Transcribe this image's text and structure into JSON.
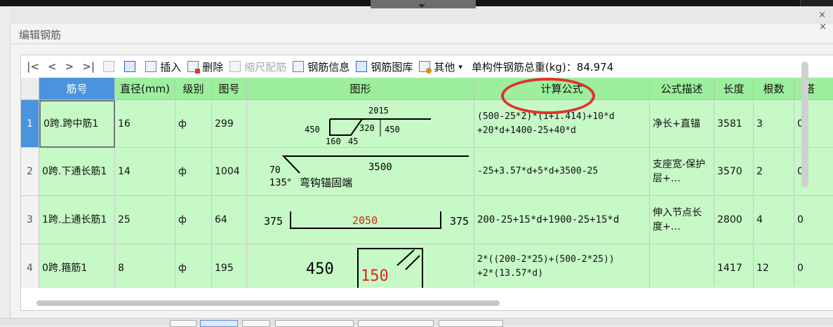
{
  "panel": {
    "title": "编辑钢筋",
    "close": "×"
  },
  "toolbar": {
    "nav": [
      "|<",
      "<",
      ">",
      ">|"
    ],
    "insert": "插入",
    "delete": "删除",
    "scale": "缩尺配筋",
    "info": "钢筋信息",
    "library": "钢筋图库",
    "other": "其他",
    "other_caret": "▾",
    "weight": "单构件钢筋总重(kg)：84.974"
  },
  "columns": [
    "筋号",
    "直径(mm)",
    "级别",
    "图号",
    "图形",
    "计算公式",
    "公式描述",
    "长度",
    "根数",
    "搭"
  ],
  "rows": [
    {
      "num": "1",
      "name": "0跨.跨中筋1",
      "dia": "16",
      "grade": "ф",
      "fig": "299",
      "formula": [
        "(500-25*2)*(1+1.414)+10*d",
        "+20*d+1400-25+40*d"
      ],
      "desc": "净长+直锚",
      "len": "3581",
      "count": "3",
      "lap": "0",
      "shape": {
        "top": "2015",
        "left": "450",
        "mid": "320",
        "right": "450",
        "b1": "160",
        "b2": "45"
      }
    },
    {
      "num": "2",
      "name": "0跨.下通长筋1",
      "dia": "14",
      "grade": "ф",
      "fig": "1004",
      "formula": [
        "-25+3.57*d+5*d+3500-25"
      ],
      "desc": "支座宽-保护层+…",
      "len": "3570",
      "count": "2",
      "lap": "0",
      "shape": {
        "hook": "70",
        "main": "3500",
        "angle": "135°",
        "note": "弯钩锚固端"
      }
    },
    {
      "num": "3",
      "name": "1跨.上通长筋1",
      "dia": "25",
      "grade": "ф",
      "fig": "64",
      "formula": [
        "200-25+15*d+1900-25+15*d"
      ],
      "desc": "伸入节点长度+…",
      "len": "2800",
      "count": "4",
      "lap": "0",
      "shape": {
        "left": "375",
        "mid": "2050",
        "right": "375"
      }
    },
    {
      "num": "4",
      "name": "0跨.箍筋1",
      "dia": "8",
      "grade": "ф",
      "fig": "195",
      "formula": [
        "2*((200-2*25)+(500-2*25))",
        "+2*(13.57*d)"
      ],
      "desc": "",
      "len": "1417",
      "count": "12",
      "lap": "0",
      "shape": {
        "h": "450",
        "w": "150"
      }
    }
  ],
  "colors": {
    "header": "#9dee9d",
    "row": "#c6f9c6",
    "selected": "#4a93dd",
    "highlight": "#e0322b",
    "red_text": "#d8281e"
  }
}
